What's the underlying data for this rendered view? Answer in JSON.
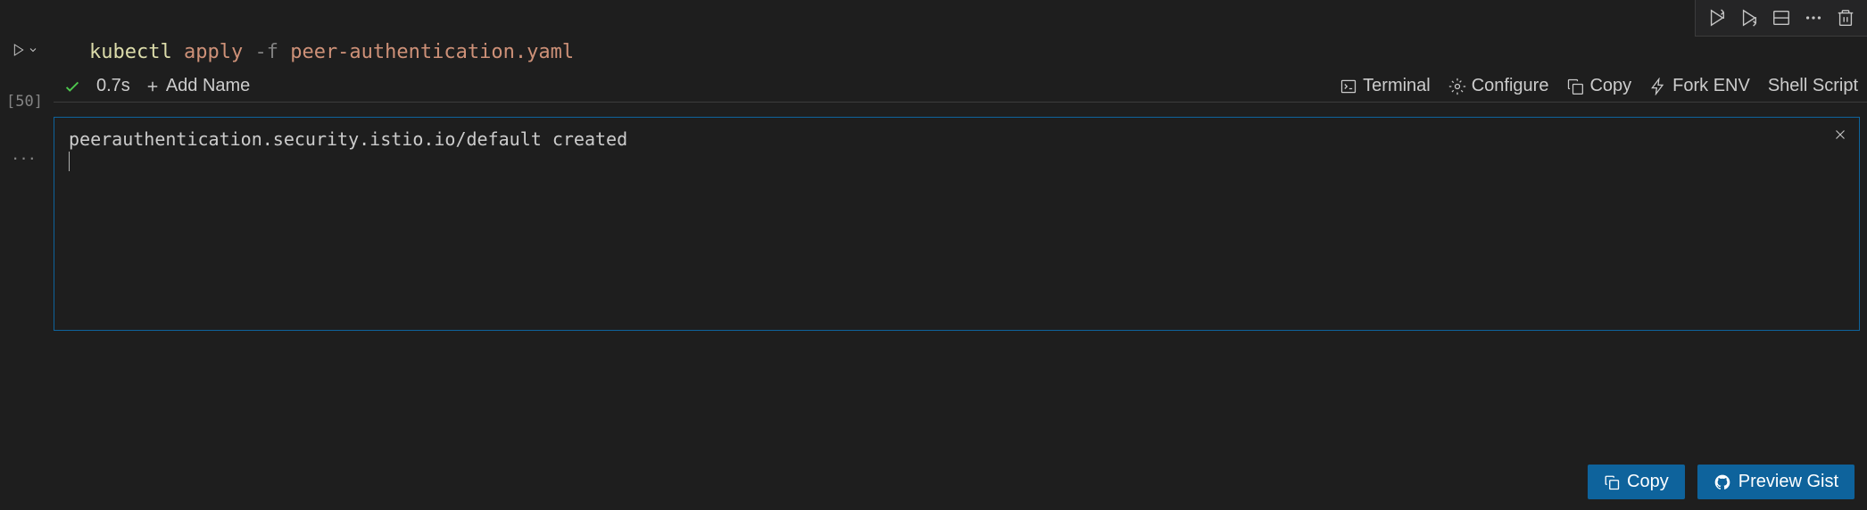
{
  "toolbar": {
    "run_above": "run-above",
    "run_below": "run-below",
    "split": "split",
    "more": "more",
    "delete": "delete"
  },
  "gutter": {
    "cell_index": "[50]"
  },
  "command": {
    "base": "kubectl",
    "sub": "apply",
    "flag": "-f",
    "arg": "peer-authentication.yaml"
  },
  "status": {
    "duration": "0.7s",
    "add_name": "Add Name",
    "terminal": "Terminal",
    "configure": "Configure",
    "copy": "Copy",
    "fork_env": "Fork ENV",
    "shell_script": "Shell Script"
  },
  "output": {
    "text": "peerauthentication.security.istio.io/default created"
  },
  "bottom": {
    "copy": "Copy",
    "preview_gist": "Preview Gist"
  }
}
